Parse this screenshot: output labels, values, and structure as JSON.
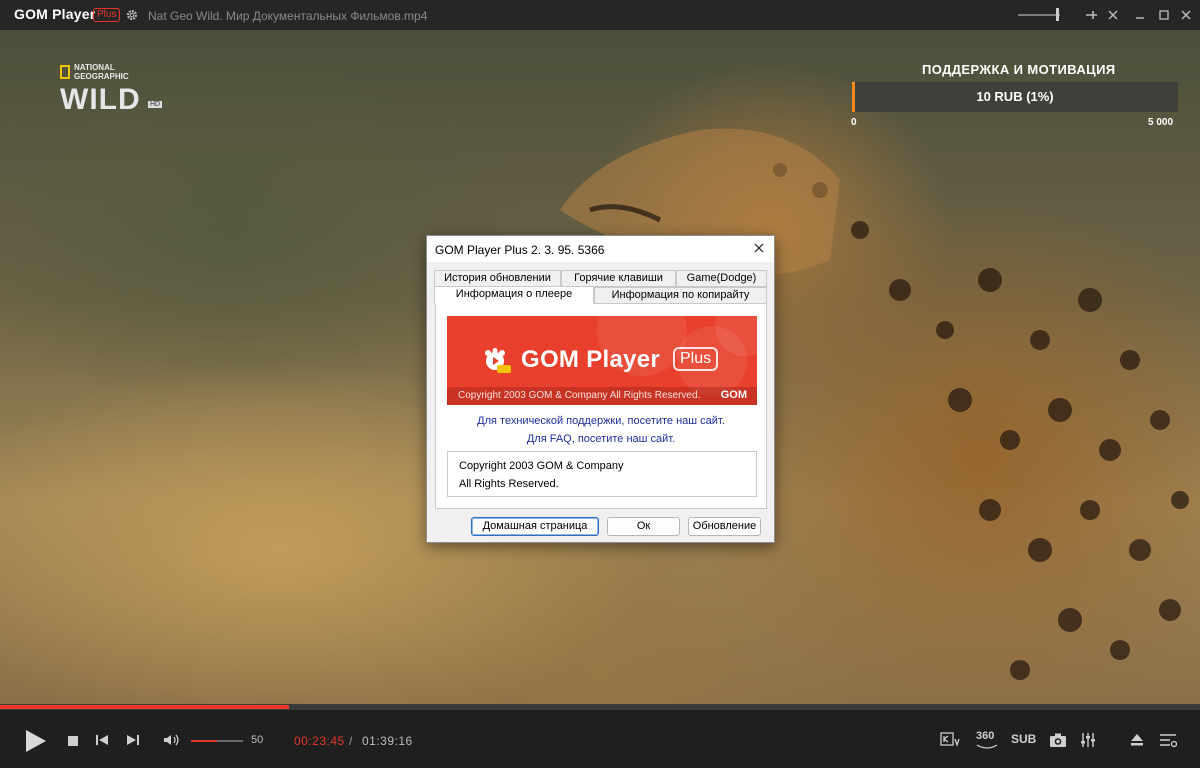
{
  "titlebar": {
    "app_name": "GOM Player",
    "app_badge": "Plus",
    "file_name": "Nat Geo Wild. Мир Документальных Фильмов.mp4",
    "icons": [
      "gear-icon",
      "pin-icon",
      "minimize-icon",
      "maximize-icon",
      "close-icon"
    ]
  },
  "overlay": {
    "channel_small": "NATIONAL GEOGRAPHIC",
    "channel_big": "WILD",
    "channel_hd": "HD",
    "donation_title": "ПОДДЕРЖКА И МОТИВАЦИЯ",
    "donation_amount": "10 RUB (1%)",
    "donation_progress": 0.01,
    "donation_min": "0",
    "donation_max": "5 000",
    "accent": "#f08a1c"
  },
  "dialog": {
    "title": "GOM Player Plus 2. 3. 95. 5366",
    "tabs_row1": [
      "История обновлении",
      "Горячие клавиши",
      "Game(Dodge)"
    ],
    "tabs_row2": [
      "Информация о плеере",
      "Информация по копирайту"
    ],
    "active_tab": "Информация о плеере",
    "banner": {
      "title": "GOM Player",
      "plus": "Plus",
      "copyright": "Copyright 2003 GOM & Company All Rights Reserved.",
      "brand": "GOM",
      "color": "#e8402c"
    },
    "link_support": "Для технической поддержки, посетите наш сайт.",
    "link_faq": "Для FAQ, посетите наш сайт.",
    "copy_line1": "Copyright 2003 GOM & Company",
    "copy_line2": "All Rights Reserved.",
    "buttons": {
      "home": "Домашная страница",
      "ok": "Ок",
      "update": "Обновление"
    }
  },
  "playback": {
    "progress": 0.241,
    "volume": 50,
    "volume_fraction": 0.5,
    "current_time": "00:23:45",
    "separator": "/",
    "total_time": "01:39:16",
    "right_buttons": {
      "vr": "360",
      "sub": "SUB"
    },
    "accent": "#e8372a"
  }
}
